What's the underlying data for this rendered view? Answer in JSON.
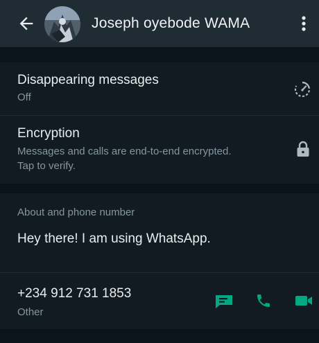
{
  "header": {
    "contact_name": "Joseph oyebode WAMA",
    "back_icon": "arrow-left-icon",
    "menu_icon": "more-vertical-icon"
  },
  "disappearing": {
    "title": "Disappearing messages",
    "value": "Off",
    "icon": "timer-icon"
  },
  "encryption": {
    "title": "Encryption",
    "line1": "Messages and calls are end-to-end encrypted.",
    "line2": "Tap to verify.",
    "icon": "lock-icon"
  },
  "about": {
    "section_label": "About and phone number",
    "status": "Hey there! I am using WhatsApp."
  },
  "phone": {
    "number": "+234 912 731 1853",
    "type": "Other",
    "actions": [
      "message-icon",
      "call-icon",
      "video-call-icon"
    ]
  },
  "colors": {
    "accent": "#00a884",
    "header_bg": "#1f2c34",
    "panel_bg": "#111b21",
    "page_bg": "#0b141a"
  }
}
